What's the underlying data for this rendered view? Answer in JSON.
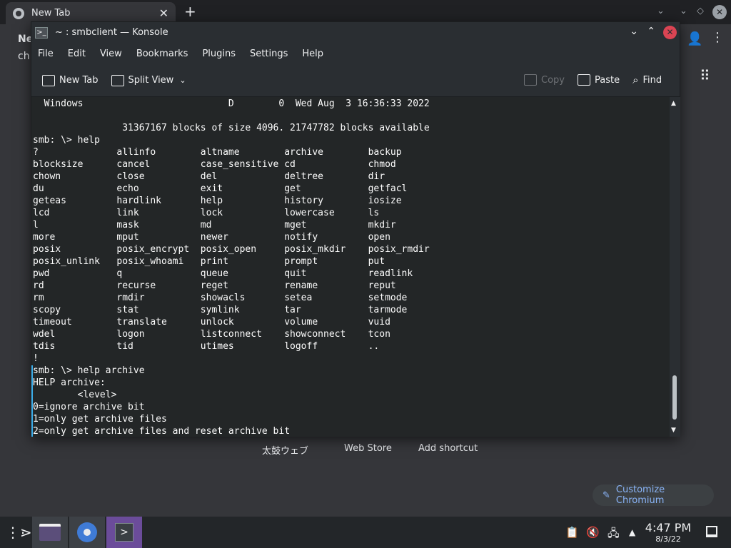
{
  "browser": {
    "tab_title": "New Tab",
    "tab_close": "✕",
    "new_tab": "+",
    "side_text_1": "Ne",
    "side_text_2": "ch",
    "shortcuts": [
      "太鼓ウェブ",
      "Web Store",
      "Add shortcut"
    ],
    "customize_label": "Customize Chromium"
  },
  "konsole": {
    "title": "~ : smbclient — Konsole",
    "menu": [
      "File",
      "Edit",
      "View",
      "Bookmarks",
      "Plugins",
      "Settings",
      "Help"
    ],
    "toolbar": {
      "new_tab": "New Tab",
      "split_view": "Split View",
      "copy": "Copy",
      "paste": "Paste",
      "find": "Find"
    },
    "terminal_lines": [
      "  Windows                          D        0  Wed Aug  3 16:36:33 2022",
      "",
      "                31367167 blocks of size 4096. 21747782 blocks available",
      "smb: \\> help",
      "?              allinfo        altname        archive        backup",
      "blocksize      cancel         case_sensitive cd             chmod",
      "chown          close          del            deltree        dir",
      "du             echo           exit           get            getfacl",
      "geteas         hardlink       help           history        iosize",
      "lcd            link           lock           lowercase      ls",
      "l              mask           md             mget           mkdir",
      "more           mput           newer          notify         open",
      "posix          posix_encrypt  posix_open     posix_mkdir    posix_rmdir",
      "posix_unlink   posix_whoami   print          prompt         put",
      "pwd            q              queue          quit           readlink",
      "rd             recurse        reget          rename         reput",
      "rm             rmdir          showacls       setea          setmode",
      "scopy          stat           symlink        tar            tarmode",
      "timeout        translate      unlock         volume         vuid",
      "wdel           logon          listconnect    showconnect    tcon",
      "tdis           tid            utimes         logoff         ..",
      "!",
      "smb: \\> help archive",
      "HELP archive:",
      "        <level>",
      "0=ignore archive bit",
      "1=only get archive files",
      "2=only get archive files and reset archive bit"
    ]
  },
  "taskbar": {
    "time": "4:47 PM",
    "date": "8/3/22"
  },
  "colors": {
    "terminal_bg": "#232627",
    "konsole_chrome": "#2a2e32",
    "accent": "#3daee9",
    "close_red": "#da4453"
  }
}
